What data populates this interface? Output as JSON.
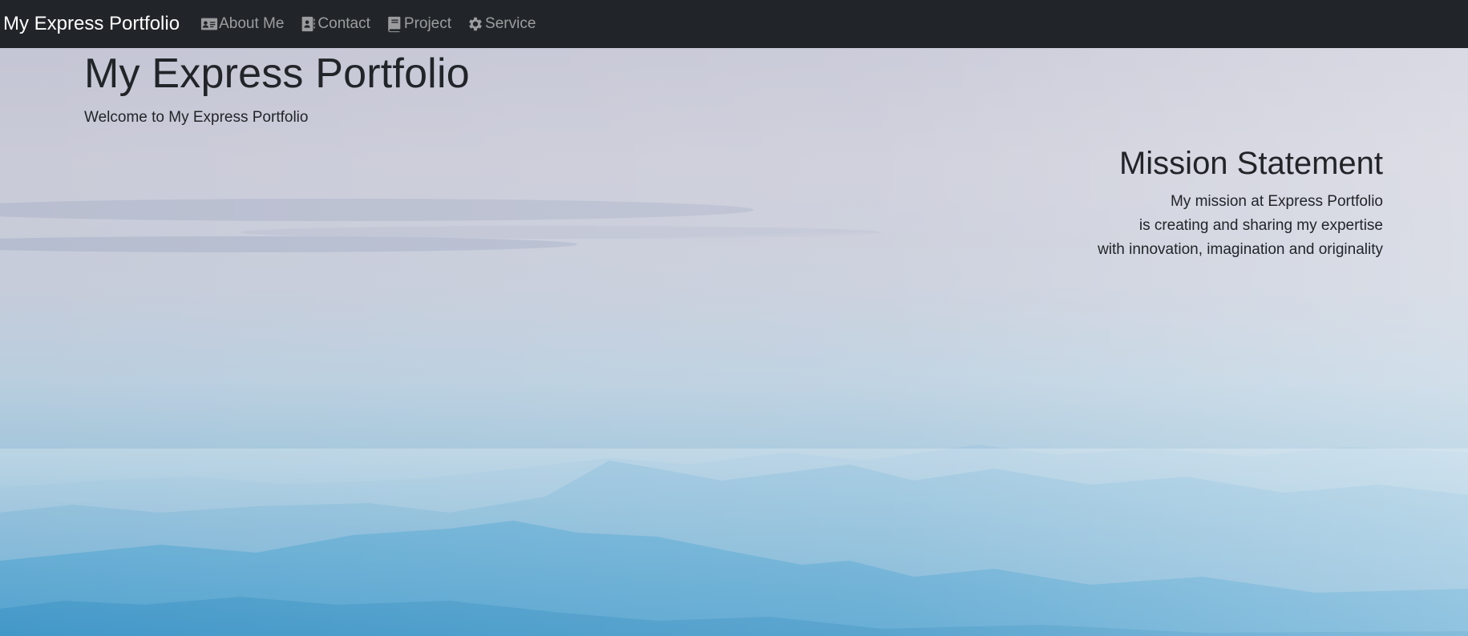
{
  "navbar": {
    "brand": "My Express Portfolio",
    "items": [
      {
        "label": "About Me",
        "icon": "address-card-icon"
      },
      {
        "label": "Contact",
        "icon": "contact-book-icon"
      },
      {
        "label": "Project",
        "icon": "book-icon"
      },
      {
        "label": "Service",
        "icon": "gear-icon"
      }
    ]
  },
  "hero": {
    "title": "My Express Portfolio",
    "subtitle": "Welcome to My Express Portfolio"
  },
  "mission": {
    "title": "Mission Statement",
    "lines": [
      "My mission at Express Portfolio",
      "is creating and sharing my expertise",
      "with innovation, imagination and originality"
    ]
  },
  "colors": {
    "navbar_bg": "#212529",
    "text_dark": "#212529",
    "nav_link": "#9a9da0",
    "sky_top": "#c2c3d3",
    "mountains": "#4a9fcd"
  }
}
